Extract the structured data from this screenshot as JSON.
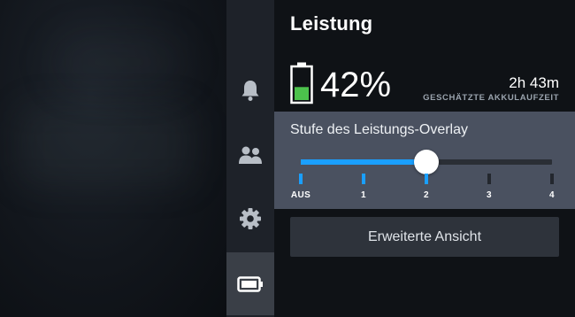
{
  "panel": {
    "title": "Leistung"
  },
  "battery": {
    "percent_label": "42%",
    "level": 0.42,
    "time_remaining": "2h 43m",
    "time_caption": "GESCHÄTZTE AKKULAUFZEIT"
  },
  "overlay": {
    "label": "Stufe des Leistungs-Overlay",
    "selected_index": 2,
    "ticks": [
      "AUS",
      "1",
      "2",
      "3",
      "4"
    ]
  },
  "advanced_button": {
    "label": "Erweiterte Ansicht"
  },
  "sidebar": {
    "items": [
      {
        "icon": "bell-icon",
        "active": false
      },
      {
        "icon": "friends-icon",
        "active": false
      },
      {
        "icon": "gear-icon",
        "active": false
      },
      {
        "icon": "battery-icon",
        "active": true
      }
    ]
  },
  "colors": {
    "accent": "#1a9fff",
    "battery_fill": "#4cc24c",
    "section_bg": "#4a5160"
  }
}
